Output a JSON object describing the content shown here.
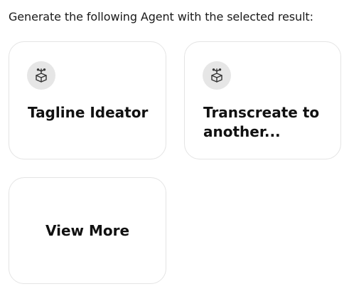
{
  "heading": "Generate the following Agent with the selected result:",
  "cards": [
    {
      "title": "Tagline Ideator",
      "icon": "agent-box-icon"
    },
    {
      "title": "Transcreate to another...",
      "icon": "agent-box-icon"
    }
  ],
  "view_more_label": "View More"
}
